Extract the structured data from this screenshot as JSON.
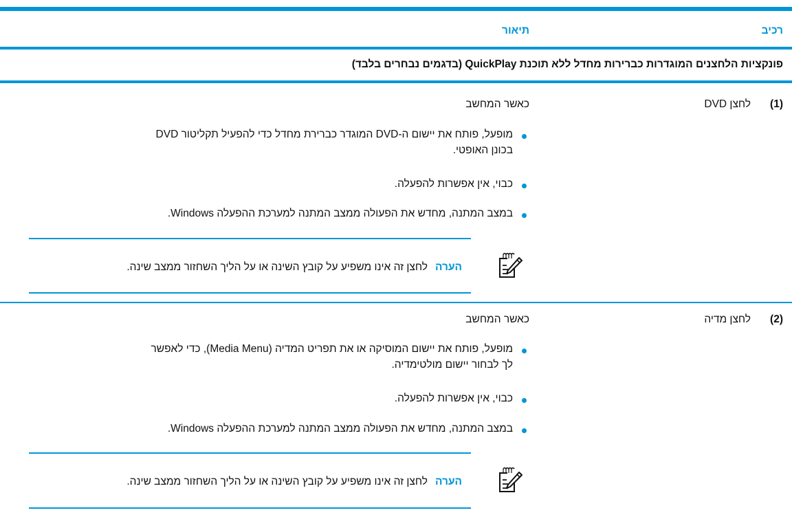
{
  "header": {
    "col_component": "רכיב",
    "col_description": "תיאור"
  },
  "section_title": "פונקציות הלחצנים המוגדרות כברירות מחדל ללא תוכנת QuickPlay (בדגמים נבחרים בלבד)",
  "rows": [
    {
      "number": "(1)",
      "component": "לחצן DVD",
      "intro": "כאשר המחשב",
      "bullets": [
        [
          "מופעל, פותח את יישום ה-DVD המוגדר כברירת מחדל כדי להפעיל תקליטור DVD",
          "בכונן האופטי."
        ],
        [
          "כבוי, אין אפשרות להפעלה."
        ],
        [
          "במצב המתנה, מחדש את הפעולה ממצב המתנה למערכת ההפעלה Windows."
        ]
      ],
      "note_label": "הערה",
      "note_text": "לחצן זה אינו משפיע על קובץ השינה או על הליך השחזור ממצב שינה."
    },
    {
      "number": "(2)",
      "component": "לחצן מדיה",
      "intro": "כאשר המחשב",
      "bullets": [
        [
          "מופעל, פותח את יישום המוסיקה או את תפריט המדיה (Media Menu), כדי לאפשר",
          "לך לבחור יישום מולטימדיה."
        ],
        [
          "כבוי, אין אפשרות להפעלה."
        ],
        [
          "במצב המתנה, מחדש את הפעולה ממצב המתנה למערכת ההפעלה Windows."
        ]
      ],
      "note_label": "הערה",
      "note_text": "לחצן זה אינו משפיע על קובץ השינה או על הליך השחזור ממצב שינה."
    }
  ],
  "colors": {
    "accent": "#0096d6",
    "text": "#111111"
  },
  "icons": {
    "note": "note-pencil-icon",
    "bullet": "bullet-dot"
  }
}
